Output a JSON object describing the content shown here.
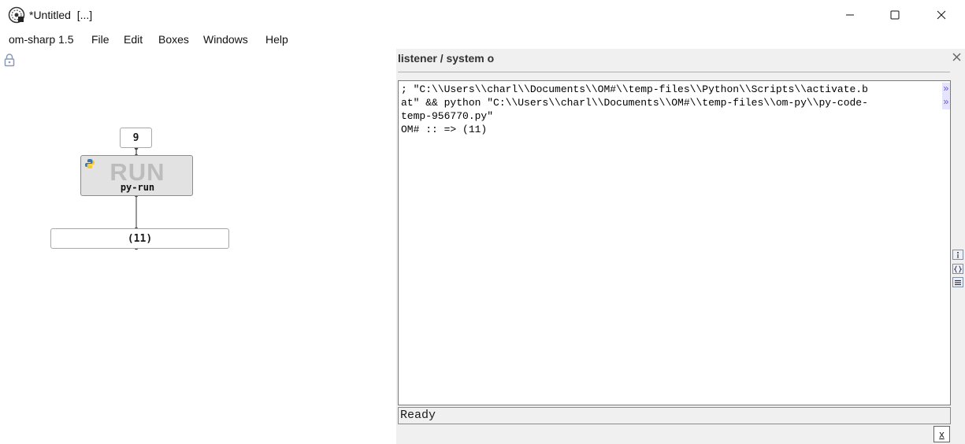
{
  "window": {
    "title": "*Untitled  [...]",
    "app_icon": "om-sharp-logo-icon",
    "controls": [
      "minimize-icon",
      "maximize-icon",
      "close-icon"
    ]
  },
  "menu": {
    "items": [
      "om-sharp 1.5",
      "File",
      "Edit",
      "Boxes",
      "Windows",
      "Help"
    ]
  },
  "patch": {
    "lock_icon": "lock-icon",
    "input_box": {
      "value": "9"
    },
    "pyrun_box": {
      "run_label": "RUN",
      "name": "py-run",
      "icon": "python-icon"
    },
    "output_box": {
      "value": "(11)"
    }
  },
  "listener": {
    "title": "listener / system o",
    "output_lines": [
      "; \"C:\\\\Users\\\\charl\\\\Documents\\\\OM#\\\\temp-files\\\\Python\\\\Scripts\\\\activate.b",
      "at\" && python \"C:\\\\Users\\\\charl\\\\Documents\\\\OM#\\\\temp-files\\\\om-py\\\\py-code-",
      "temp-956770.py\"",
      "OM# :: => (11)"
    ],
    "wrap_marker": "»",
    "status": "Ready",
    "clear_label": "x",
    "side_buttons": [
      "info-icon",
      "braces-icon",
      "list-icon"
    ]
  }
}
